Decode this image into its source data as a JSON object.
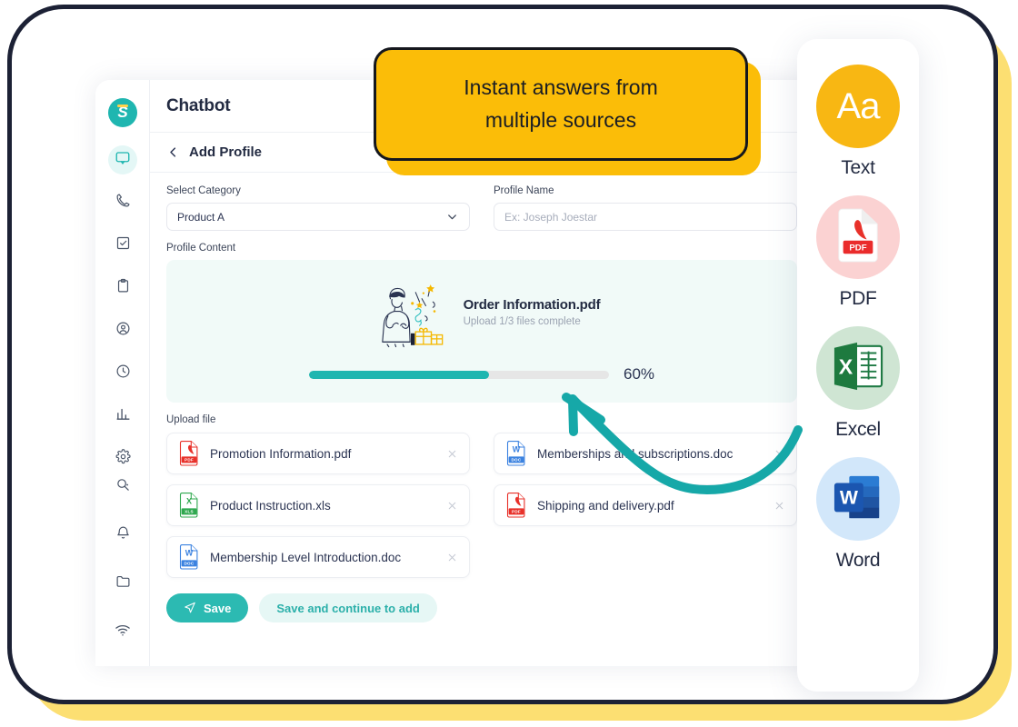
{
  "callout": {
    "line1": "Instant answers from",
    "line2": "multiple sources",
    "bg_color": "#FBBD08",
    "border_color": "#15171D"
  },
  "app": {
    "logo_letter": "S",
    "title": "Chatbot",
    "subheader_title": "Add Profile",
    "back_icon": "chevron-left-icon"
  },
  "sidebar": {
    "items": [
      {
        "icon": "chat-bubble-icon",
        "active": true
      },
      {
        "icon": "phone-icon",
        "active": false
      },
      {
        "icon": "checkbox-icon",
        "active": false
      },
      {
        "icon": "clipboard-icon",
        "active": false
      },
      {
        "icon": "user-circle-icon",
        "active": false
      },
      {
        "icon": "clock-icon",
        "active": false
      },
      {
        "icon": "bar-chart-icon",
        "active": false
      },
      {
        "icon": "gear-icon",
        "active": false
      }
    ],
    "bottom_items": [
      {
        "icon": "user-search-icon"
      },
      {
        "icon": "bell-icon"
      },
      {
        "icon": "folder-icon"
      },
      {
        "icon": "wifi-icon"
      }
    ]
  },
  "form": {
    "category_label": "Select Category",
    "category_value": "Product A",
    "profile_name_label": "Profile Name",
    "profile_name_placeholder": "Ex: Joseph Joestar",
    "profile_content_label": "Profile Content",
    "upload_file_label": "Upload file"
  },
  "upload": {
    "filename": "Order Information.pdf",
    "status": "Upload 1/3 files complete",
    "progress_percent": 60,
    "progress_label": "60%",
    "fill_color": "#1FB6B0",
    "track_color": "#E6E6E6",
    "panel_bg": "#F1FAF8"
  },
  "files": [
    {
      "name": "Promotion Information.pdf",
      "type": "pdf",
      "remove_icon": "close-icon"
    },
    {
      "name": "Memberships and subscriptions.doc",
      "type": "doc",
      "remove_icon": "close-icon"
    },
    {
      "name": "Product Instruction.xls",
      "type": "xls",
      "remove_icon": "close-icon"
    },
    {
      "name": "Shipping and delivery.pdf",
      "type": "pdf",
      "remove_icon": "close-icon"
    },
    {
      "name": "Membership Level Introduction.doc",
      "type": "doc",
      "remove_icon": "close-icon"
    }
  ],
  "buttons": {
    "save_label": "Save",
    "save_icon": "send-icon",
    "save_continue_label": "Save and continue to add",
    "primary_color": "#2CBAB2",
    "secondary_color": "#E6F7F5"
  },
  "file_types": [
    {
      "label": "Text",
      "icon": "text-aa-icon",
      "glyph": "Aa",
      "circle_color": "#F8B713"
    },
    {
      "label": "PDF",
      "icon": "pdf-file-icon",
      "circle_color": "#FBD2D2"
    },
    {
      "label": "Excel",
      "icon": "excel-file-icon",
      "circle_color": "#CFE5D3"
    },
    {
      "label": "Word",
      "icon": "word-file-icon",
      "circle_color": "#D2E7FA"
    }
  ],
  "decor": {
    "frame_border_color": "#1C2135",
    "frame_shadow_color": "#FCDF72",
    "arrow_color": "#16A8A8",
    "arrow_name": "curved-arrow-pointing-to-progress-bar"
  }
}
